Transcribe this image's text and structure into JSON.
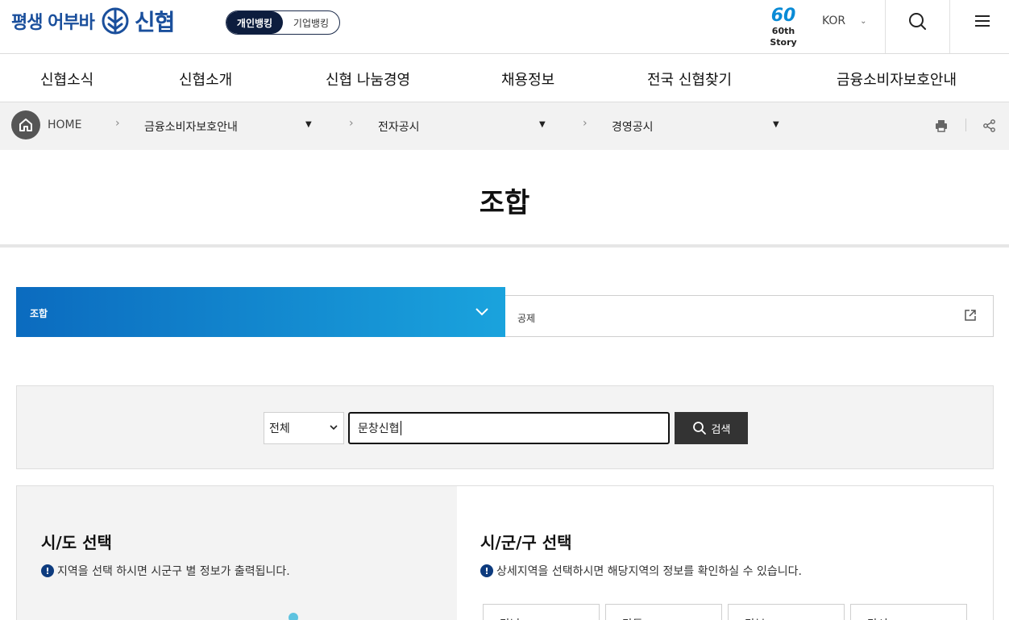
{
  "header": {
    "slogan": "평생 어부바",
    "brand": "신협",
    "bank_toggle": {
      "personal": "개인뱅킹",
      "business": "기업뱅킹"
    },
    "story_num": "60",
    "story_text": "60th Story",
    "language": "KOR"
  },
  "gnb": [
    "신협소식",
    "신협소개",
    "신협 나눔경영",
    "채용정보",
    "전국 신협찾기",
    "금융소비자보호안내"
  ],
  "breadcrumb": {
    "home": "HOME",
    "level1": "금융소비자보호안내",
    "level2": "전자공시",
    "level3": "경영공시"
  },
  "page_title": "조합",
  "tabs": {
    "active": "조합",
    "other": "공제"
  },
  "search": {
    "select_value": "전체",
    "keyword": "문창신협",
    "button": "검색"
  },
  "region": {
    "left_title": "시/도 선택",
    "left_note": "지역을 선택 하시면 시군구 별 정보가 출력됩니다.",
    "right_title": "시/군/구 선택",
    "right_note": "상세지역을 선택하시면 해당지역의 정보를 확인하실 수 있습니다.",
    "districts": [
      "강남",
      "강동",
      "강북",
      "강서"
    ]
  },
  "colors": {
    "brand_blue": "#1a4f9c",
    "tab_start": "#0b6bbf",
    "tab_end": "#1aa3dd",
    "dark_button": "#333333"
  }
}
